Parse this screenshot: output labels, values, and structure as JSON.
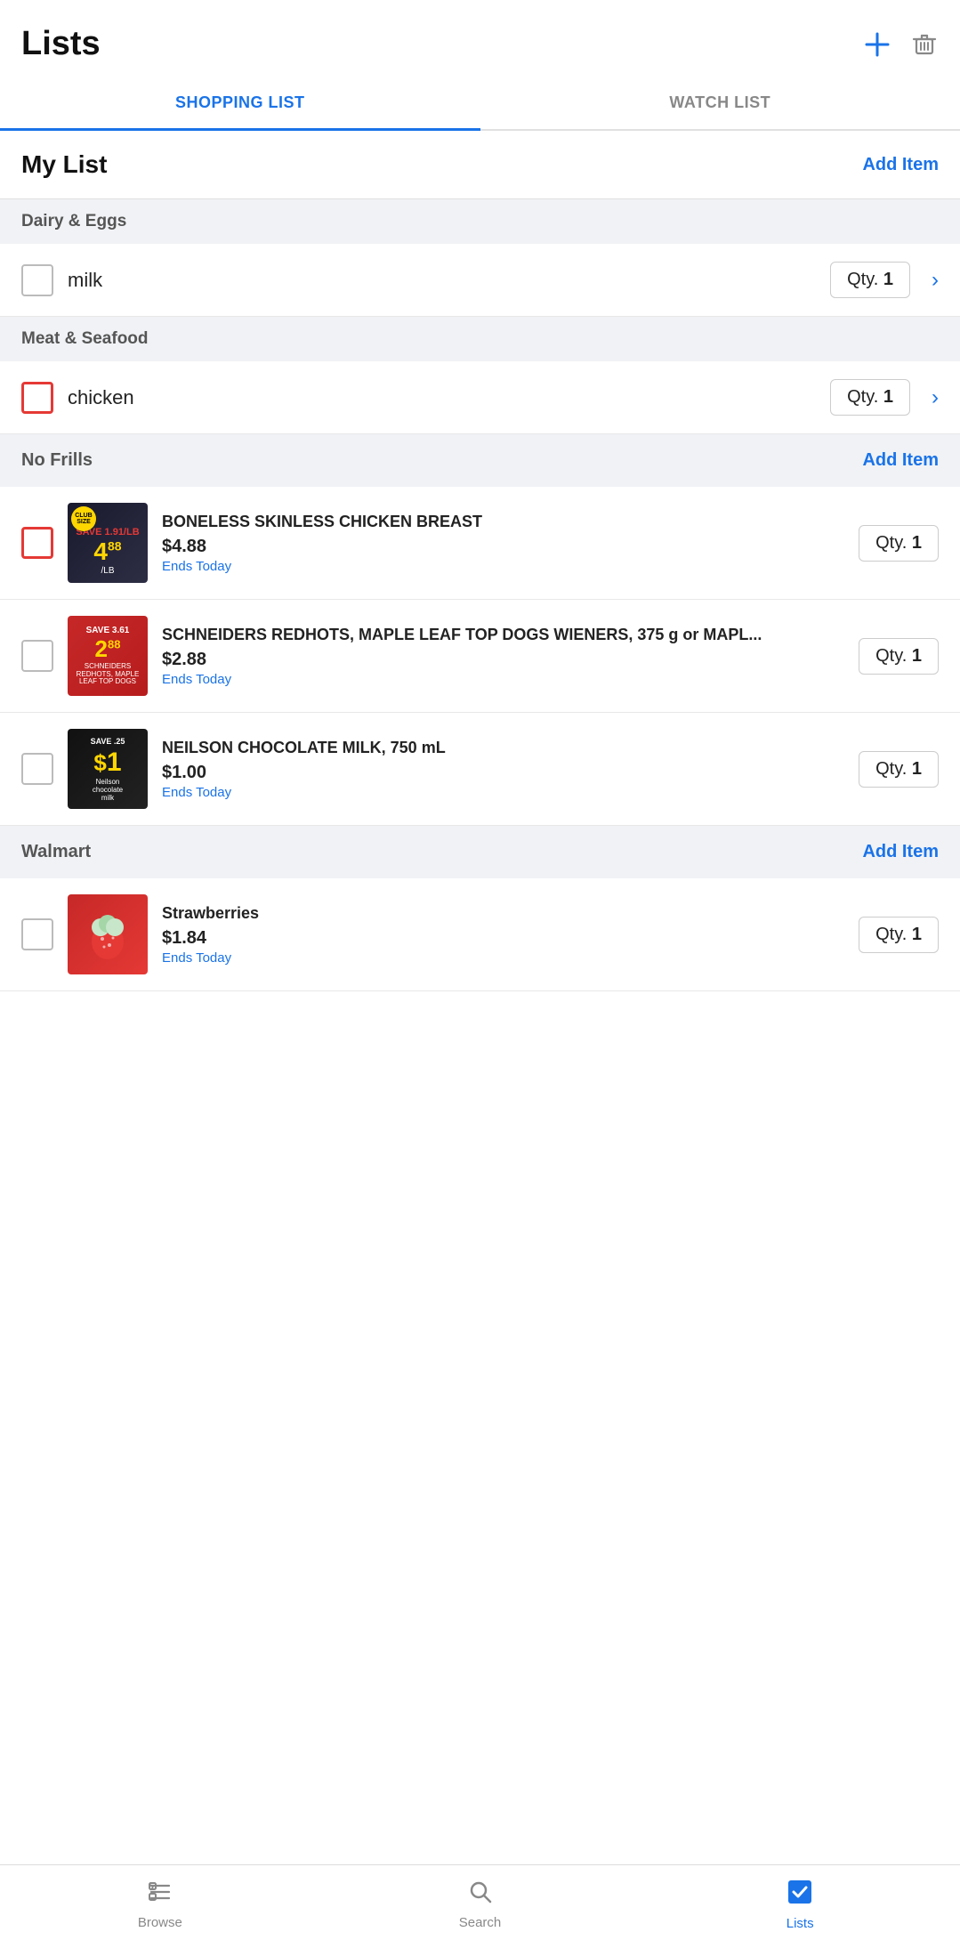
{
  "header": {
    "title": "Lists",
    "add_icon": "+",
    "delete_icon": "🗑"
  },
  "tabs": [
    {
      "id": "shopping",
      "label": "SHOPPING LIST",
      "active": true
    },
    {
      "id": "watch",
      "label": "WATCH LIST",
      "active": false
    }
  ],
  "mylist": {
    "title": "My List",
    "add_label": "Add Item"
  },
  "categories": [
    {
      "id": "dairy",
      "name": "Dairy & Eggs",
      "items": [
        {
          "id": "milk",
          "name": "milk",
          "qty": 1,
          "checked": false,
          "red_border": false
        }
      ]
    },
    {
      "id": "meat",
      "name": "Meat & Seafood",
      "items": [
        {
          "id": "chicken",
          "name": "chicken",
          "qty": 1,
          "checked": false,
          "red_border": true
        }
      ]
    }
  ],
  "stores": [
    {
      "id": "nofrills",
      "name": "No Frills",
      "add_label": "Add Item",
      "products": [
        {
          "id": "chicken-breast",
          "name": "BONELESS SKINLESS CHICKEN BREAST",
          "price": "$4.88",
          "ends": "Ends Today",
          "qty": 1,
          "checked": false,
          "red_border": true,
          "img_type": "chicken"
        },
        {
          "id": "schneiders",
          "name": "SCHNEIDERS REDHOTS, MAPLE LEAF TOP DOGS WIENERS, 375 g or MAPL...",
          "price": "$2.88",
          "ends": "Ends Today",
          "qty": 1,
          "checked": false,
          "red_border": false,
          "img_type": "schneiders"
        },
        {
          "id": "neilson",
          "name": "NEILSON CHOCOLATE MILK, 750 mL",
          "price": "$1.00",
          "ends": "Ends Today",
          "qty": 1,
          "checked": false,
          "red_border": false,
          "img_type": "neilson"
        }
      ]
    },
    {
      "id": "walmart",
      "name": "Walmart",
      "add_label": "Add Item",
      "products": [
        {
          "id": "strawberries",
          "name": "Strawberries",
          "price": "$1.84",
          "ends": "Ends Today",
          "qty": 1,
          "checked": false,
          "red_border": false,
          "img_type": "strawberry"
        }
      ]
    }
  ],
  "bottom_nav": [
    {
      "id": "browse",
      "label": "Browse",
      "icon": "tag",
      "active": false
    },
    {
      "id": "search",
      "label": "Search",
      "icon": "search",
      "active": false
    },
    {
      "id": "lists",
      "label": "Lists",
      "icon": "lists",
      "active": true
    }
  ]
}
